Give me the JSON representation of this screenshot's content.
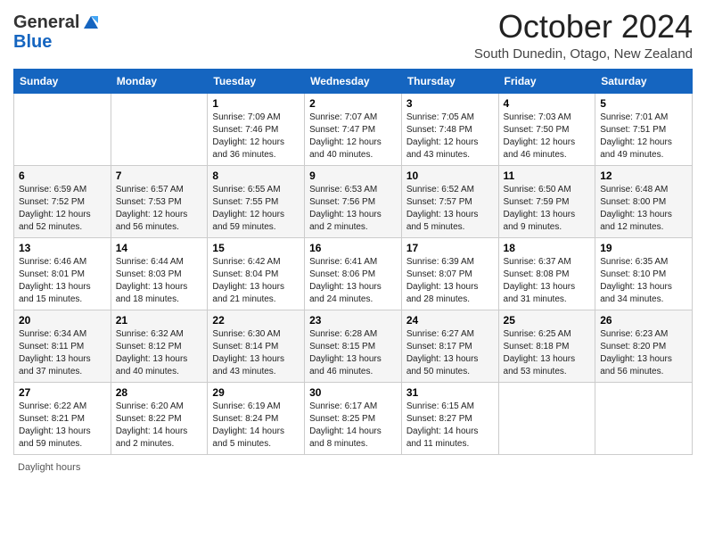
{
  "header": {
    "logo_general": "General",
    "logo_blue": "Blue",
    "month_title": "October 2024",
    "location": "South Dunedin, Otago, New Zealand"
  },
  "weekdays": [
    "Sunday",
    "Monday",
    "Tuesday",
    "Wednesday",
    "Thursday",
    "Friday",
    "Saturday"
  ],
  "weeks": [
    [
      {
        "day": "",
        "info": ""
      },
      {
        "day": "",
        "info": ""
      },
      {
        "day": "1",
        "info": "Sunrise: 7:09 AM\nSunset: 7:46 PM\nDaylight: 12 hours and 36 minutes."
      },
      {
        "day": "2",
        "info": "Sunrise: 7:07 AM\nSunset: 7:47 PM\nDaylight: 12 hours and 40 minutes."
      },
      {
        "day": "3",
        "info": "Sunrise: 7:05 AM\nSunset: 7:48 PM\nDaylight: 12 hours and 43 minutes."
      },
      {
        "day": "4",
        "info": "Sunrise: 7:03 AM\nSunset: 7:50 PM\nDaylight: 12 hours and 46 minutes."
      },
      {
        "day": "5",
        "info": "Sunrise: 7:01 AM\nSunset: 7:51 PM\nDaylight: 12 hours and 49 minutes."
      }
    ],
    [
      {
        "day": "6",
        "info": "Sunrise: 6:59 AM\nSunset: 7:52 PM\nDaylight: 12 hours and 52 minutes."
      },
      {
        "day": "7",
        "info": "Sunrise: 6:57 AM\nSunset: 7:53 PM\nDaylight: 12 hours and 56 minutes."
      },
      {
        "day": "8",
        "info": "Sunrise: 6:55 AM\nSunset: 7:55 PM\nDaylight: 12 hours and 59 minutes."
      },
      {
        "day": "9",
        "info": "Sunrise: 6:53 AM\nSunset: 7:56 PM\nDaylight: 13 hours and 2 minutes."
      },
      {
        "day": "10",
        "info": "Sunrise: 6:52 AM\nSunset: 7:57 PM\nDaylight: 13 hours and 5 minutes."
      },
      {
        "day": "11",
        "info": "Sunrise: 6:50 AM\nSunset: 7:59 PM\nDaylight: 13 hours and 9 minutes."
      },
      {
        "day": "12",
        "info": "Sunrise: 6:48 AM\nSunset: 8:00 PM\nDaylight: 13 hours and 12 minutes."
      }
    ],
    [
      {
        "day": "13",
        "info": "Sunrise: 6:46 AM\nSunset: 8:01 PM\nDaylight: 13 hours and 15 minutes."
      },
      {
        "day": "14",
        "info": "Sunrise: 6:44 AM\nSunset: 8:03 PM\nDaylight: 13 hours and 18 minutes."
      },
      {
        "day": "15",
        "info": "Sunrise: 6:42 AM\nSunset: 8:04 PM\nDaylight: 13 hours and 21 minutes."
      },
      {
        "day": "16",
        "info": "Sunrise: 6:41 AM\nSunset: 8:06 PM\nDaylight: 13 hours and 24 minutes."
      },
      {
        "day": "17",
        "info": "Sunrise: 6:39 AM\nSunset: 8:07 PM\nDaylight: 13 hours and 28 minutes."
      },
      {
        "day": "18",
        "info": "Sunrise: 6:37 AM\nSunset: 8:08 PM\nDaylight: 13 hours and 31 minutes."
      },
      {
        "day": "19",
        "info": "Sunrise: 6:35 AM\nSunset: 8:10 PM\nDaylight: 13 hours and 34 minutes."
      }
    ],
    [
      {
        "day": "20",
        "info": "Sunrise: 6:34 AM\nSunset: 8:11 PM\nDaylight: 13 hours and 37 minutes."
      },
      {
        "day": "21",
        "info": "Sunrise: 6:32 AM\nSunset: 8:12 PM\nDaylight: 13 hours and 40 minutes."
      },
      {
        "day": "22",
        "info": "Sunrise: 6:30 AM\nSunset: 8:14 PM\nDaylight: 13 hours and 43 minutes."
      },
      {
        "day": "23",
        "info": "Sunrise: 6:28 AM\nSunset: 8:15 PM\nDaylight: 13 hours and 46 minutes."
      },
      {
        "day": "24",
        "info": "Sunrise: 6:27 AM\nSunset: 8:17 PM\nDaylight: 13 hours and 50 minutes."
      },
      {
        "day": "25",
        "info": "Sunrise: 6:25 AM\nSunset: 8:18 PM\nDaylight: 13 hours and 53 minutes."
      },
      {
        "day": "26",
        "info": "Sunrise: 6:23 AM\nSunset: 8:20 PM\nDaylight: 13 hours and 56 minutes."
      }
    ],
    [
      {
        "day": "27",
        "info": "Sunrise: 6:22 AM\nSunset: 8:21 PM\nDaylight: 13 hours and 59 minutes."
      },
      {
        "day": "28",
        "info": "Sunrise: 6:20 AM\nSunset: 8:22 PM\nDaylight: 14 hours and 2 minutes."
      },
      {
        "day": "29",
        "info": "Sunrise: 6:19 AM\nSunset: 8:24 PM\nDaylight: 14 hours and 5 minutes."
      },
      {
        "day": "30",
        "info": "Sunrise: 6:17 AM\nSunset: 8:25 PM\nDaylight: 14 hours and 8 minutes."
      },
      {
        "day": "31",
        "info": "Sunrise: 6:15 AM\nSunset: 8:27 PM\nDaylight: 14 hours and 11 minutes."
      },
      {
        "day": "",
        "info": ""
      },
      {
        "day": "",
        "info": ""
      }
    ]
  ],
  "footer": {
    "note": "Daylight hours"
  }
}
